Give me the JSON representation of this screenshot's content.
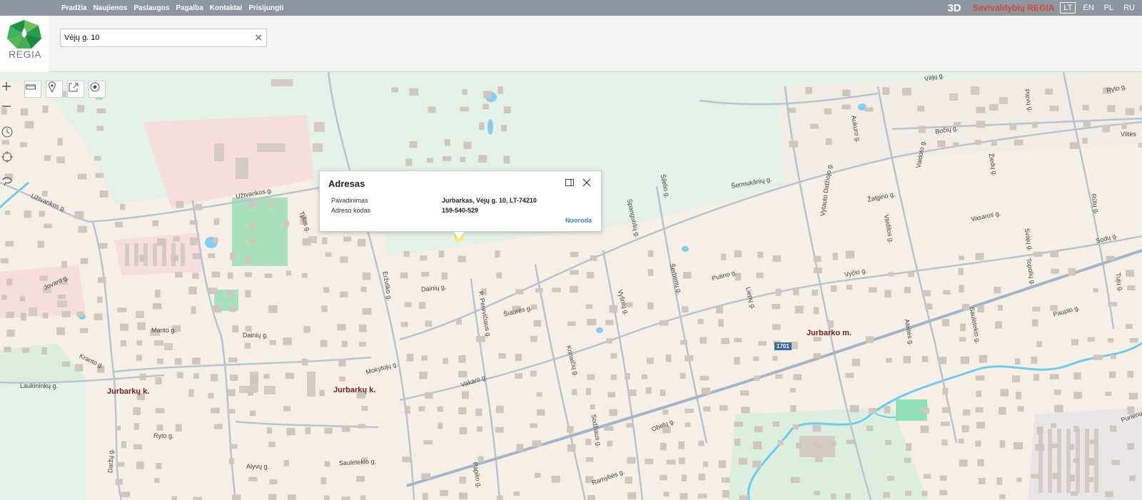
{
  "nav": {
    "items": [
      "Pradžia",
      "Naujienos",
      "Paslaugos",
      "Pagalba",
      "Kontaktai",
      "Prisijungti"
    ]
  },
  "header": {
    "btn3d": "3D",
    "brand": "Savivaldybių REGIA",
    "languages": [
      "LT",
      "EN",
      "PL",
      "RU"
    ],
    "active_language": "LT",
    "logo_text": "REGIA"
  },
  "search": {
    "value": "Vėjų g. 10"
  },
  "popup": {
    "title": "Adresas",
    "rows": [
      {
        "label": "Pavadinimas",
        "value": "Jurbarkas, Vėjų g. 10, LT-74210"
      },
      {
        "label": "Adreso kodas",
        "value": "159-540-529"
      }
    ],
    "link": "Nuoroda"
  },
  "map": {
    "places": [
      "Jurbarkų k.",
      "Jurbarkų k.",
      "Jurbarko m."
    ],
    "road_number": "1701",
    "streets": [
      "Užtvankos g.",
      "Užtvankos g.",
      "Tylos g.",
      "Eržvilko g.",
      "Dainių g.",
      "Dainių g.",
      "Jovaro g.",
      "Manto g.",
      "Kranto g.",
      "Laukininkų g.",
      "Ryto g.",
      "Daržų g.",
      "Alyvų g.",
      "Saulėtekio g.",
      "P. Perevičiaus g.",
      "Šiaurės g.",
      "Mokytojų g.",
      "Vakaro g.",
      "Krinaičių g.",
      "Sodžiaus g.",
      "Papilio g.",
      "Ramybės g.",
      "Obelų g.",
      "Vyšnių g.",
      "Šerbenų g.",
      "Putino g.",
      "Liepų g.",
      "Spanguolių g.",
      "Šilelio g.",
      "Šermukšnių g.",
      "Vytauto Didžiojo g.",
      "Aukuro g.",
      "Žalgirio g.",
      "Vaidilos g.",
      "Vaidoto g.",
      "Vyčio g.",
      "Ateitės g.",
      "Saulėtekio g.",
      "Vasaros g.",
      "Žiedų g.",
      "Bočių g.",
      "Pievų g.",
      "Ryto g.",
      "Sodų g.",
      "Paupio g.",
      "Topolių g.",
      "Rūtų g.",
      "Tujų g.",
      "Svajų g.",
      "Vėjų g.",
      "Viltės",
      "Purienų"
    ]
  }
}
